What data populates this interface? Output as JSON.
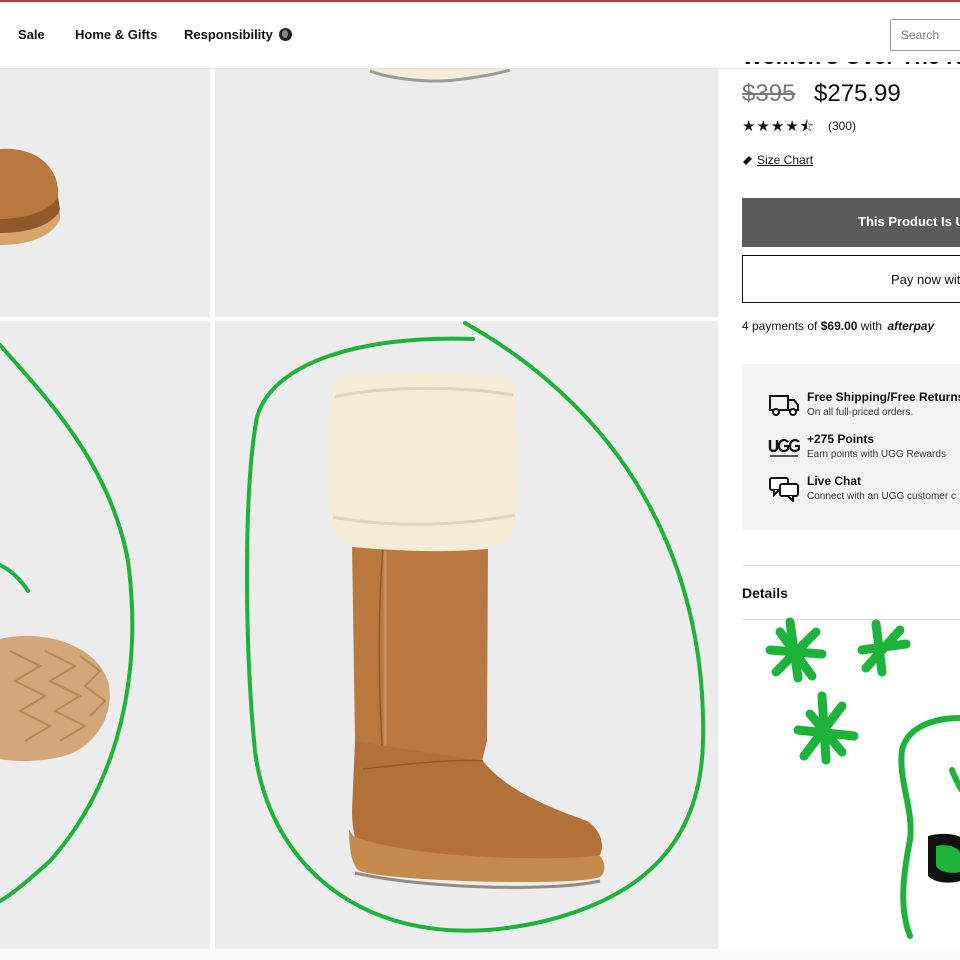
{
  "nav": {
    "items": [
      "Sale",
      "Home & Gifts",
      "Responsibility"
    ],
    "search_placeholder": "Search"
  },
  "product": {
    "title": "Women's Over The K",
    "original_price": "$395",
    "sale_price": "$275.99",
    "rating_stars": "★★★★⯪",
    "rating": 4.5,
    "review_count": "(300)",
    "size_chart_label": "Size Chart",
    "unavailable_button": "This Product Is Un",
    "pay_now_button": "Pay now wit",
    "afterpay": {
      "prefix": "4 payments of",
      "amount": "$69.00",
      "suffix": "with",
      "brand": "afterpay"
    }
  },
  "perks": [
    {
      "icon": "truck-icon",
      "title": "Free Shipping/Free Returns",
      "subtitle": "On all full-priced orders."
    },
    {
      "icon": "ugg-rewards-icon",
      "title": "+275 Points",
      "subtitle": "Earn points with UGG Rewards"
    },
    {
      "icon": "chat-icon",
      "title": "Live Chat",
      "subtitle": "Connect with an UGG customer c"
    }
  ],
  "details_label": "Details",
  "colors": {
    "accent_line": "#b04040",
    "doodle_green": "#1db33a",
    "tile_bg": "#ececec",
    "button_dark": "#5b5b5b",
    "boot_tan": "#b8783e",
    "sheepskin": "#f6ecd6"
  }
}
